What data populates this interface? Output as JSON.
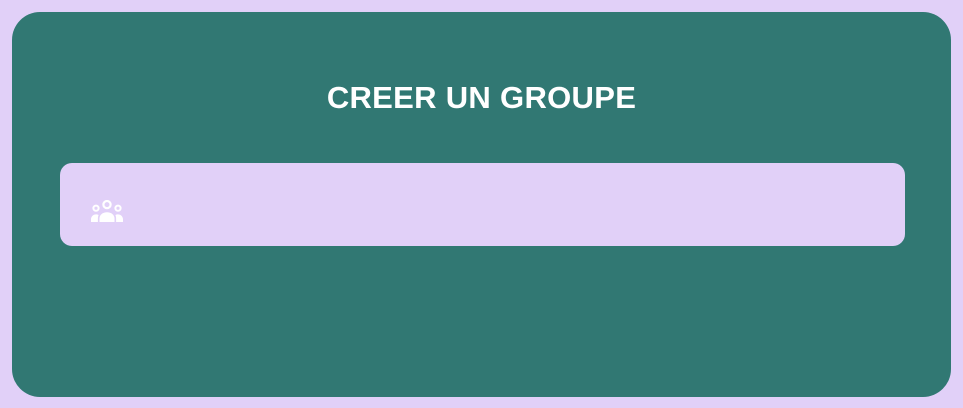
{
  "dialog": {
    "title": "CREER UN GROUPE"
  },
  "group_name_field": {
    "value": "",
    "placeholder": "",
    "icon": "group-icon"
  },
  "colors": {
    "background": "#e1d0f8",
    "card": "#317873",
    "field": "#e1d0f8",
    "title_text": "#ffffff",
    "icon": "#ffffff"
  }
}
